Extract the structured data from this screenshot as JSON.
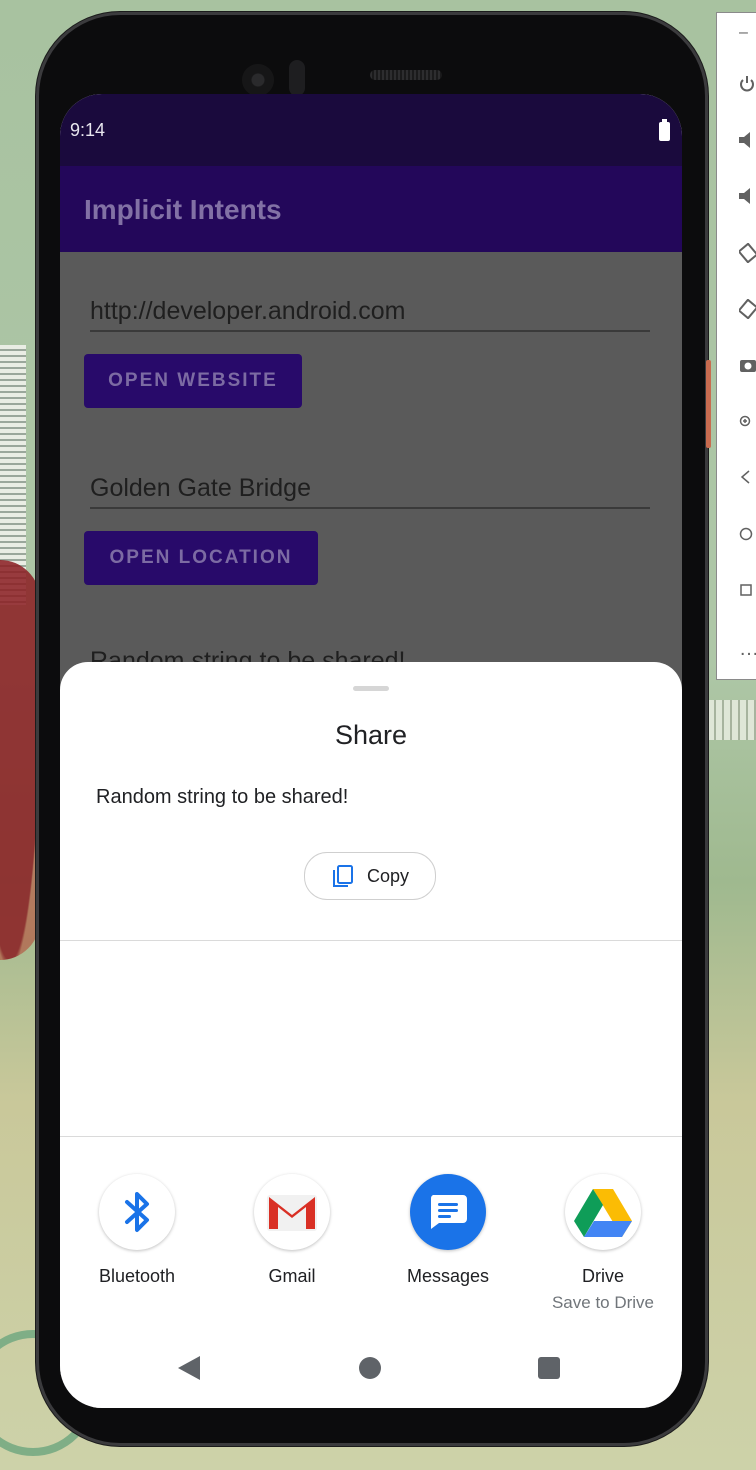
{
  "status_bar": {
    "time": "9:14"
  },
  "app": {
    "title": "Implicit Intents"
  },
  "form": {
    "website_url": "http://developer.android.com",
    "open_website_label": "OPEN WEBSITE",
    "location": "Golden Gate Bridge",
    "open_location_label": "OPEN LOCATION",
    "share_text_partial": "Random string to be shared!"
  },
  "share_sheet": {
    "title": "Share",
    "shared_text": "Random string to be shared!",
    "copy_label": "Copy",
    "targets": [
      {
        "name": "Bluetooth",
        "icon": "bluetooth-icon",
        "color": "#1a73e8"
      },
      {
        "name": "Gmail",
        "icon": "gmail-icon",
        "color": "#d93025"
      },
      {
        "name": "Messages",
        "icon": "messages-icon",
        "color": "#1a73e8"
      },
      {
        "name": "Drive",
        "subtitle": "Save to Drive",
        "icon": "drive-icon",
        "color": "#fbbc04"
      }
    ]
  },
  "emulator_toolbar": {
    "items": [
      "minimize",
      "power",
      "volume-up",
      "volume-down",
      "rotate-left",
      "rotate-right",
      "screenshot",
      "zoom",
      "back",
      "home",
      "overview",
      "more"
    ],
    "minimize_label": "–",
    "more_label": "…"
  },
  "colors": {
    "app_bar": "#23075a",
    "button": "#280a6a",
    "scrim": "#5a5a5a"
  }
}
